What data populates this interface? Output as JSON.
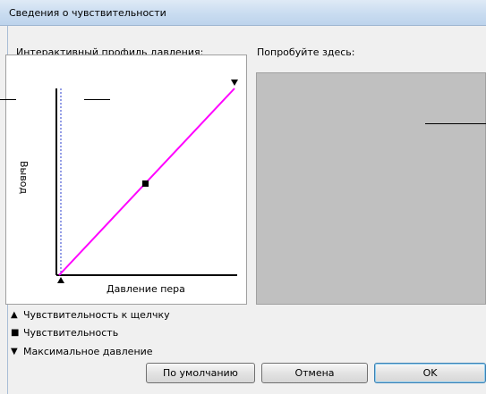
{
  "window": {
    "title": "Сведения о чувствительности"
  },
  "profile_label": "Интерактивный профиль давления:",
  "try_label": "Попробуйте здесь:",
  "graph": {
    "y_axis_label": "Вывод",
    "x_axis_label": "Давление пера",
    "curve_color": "#ff00ff",
    "threshold_line_color": "#2a3dcc"
  },
  "legend": [
    {
      "icon": "triangle-up-icon",
      "symbol": "▲",
      "label": "Чувствительность к щелчку"
    },
    {
      "icon": "square-icon",
      "symbol": "■",
      "label": "Чувствительность"
    },
    {
      "icon": "triangle-down-icon",
      "symbol": "▼",
      "label": "Максимальное давление"
    }
  ],
  "buttons": {
    "default_label": "По умолчанию",
    "cancel_label": "Отмена",
    "ok_label": "OK"
  }
}
